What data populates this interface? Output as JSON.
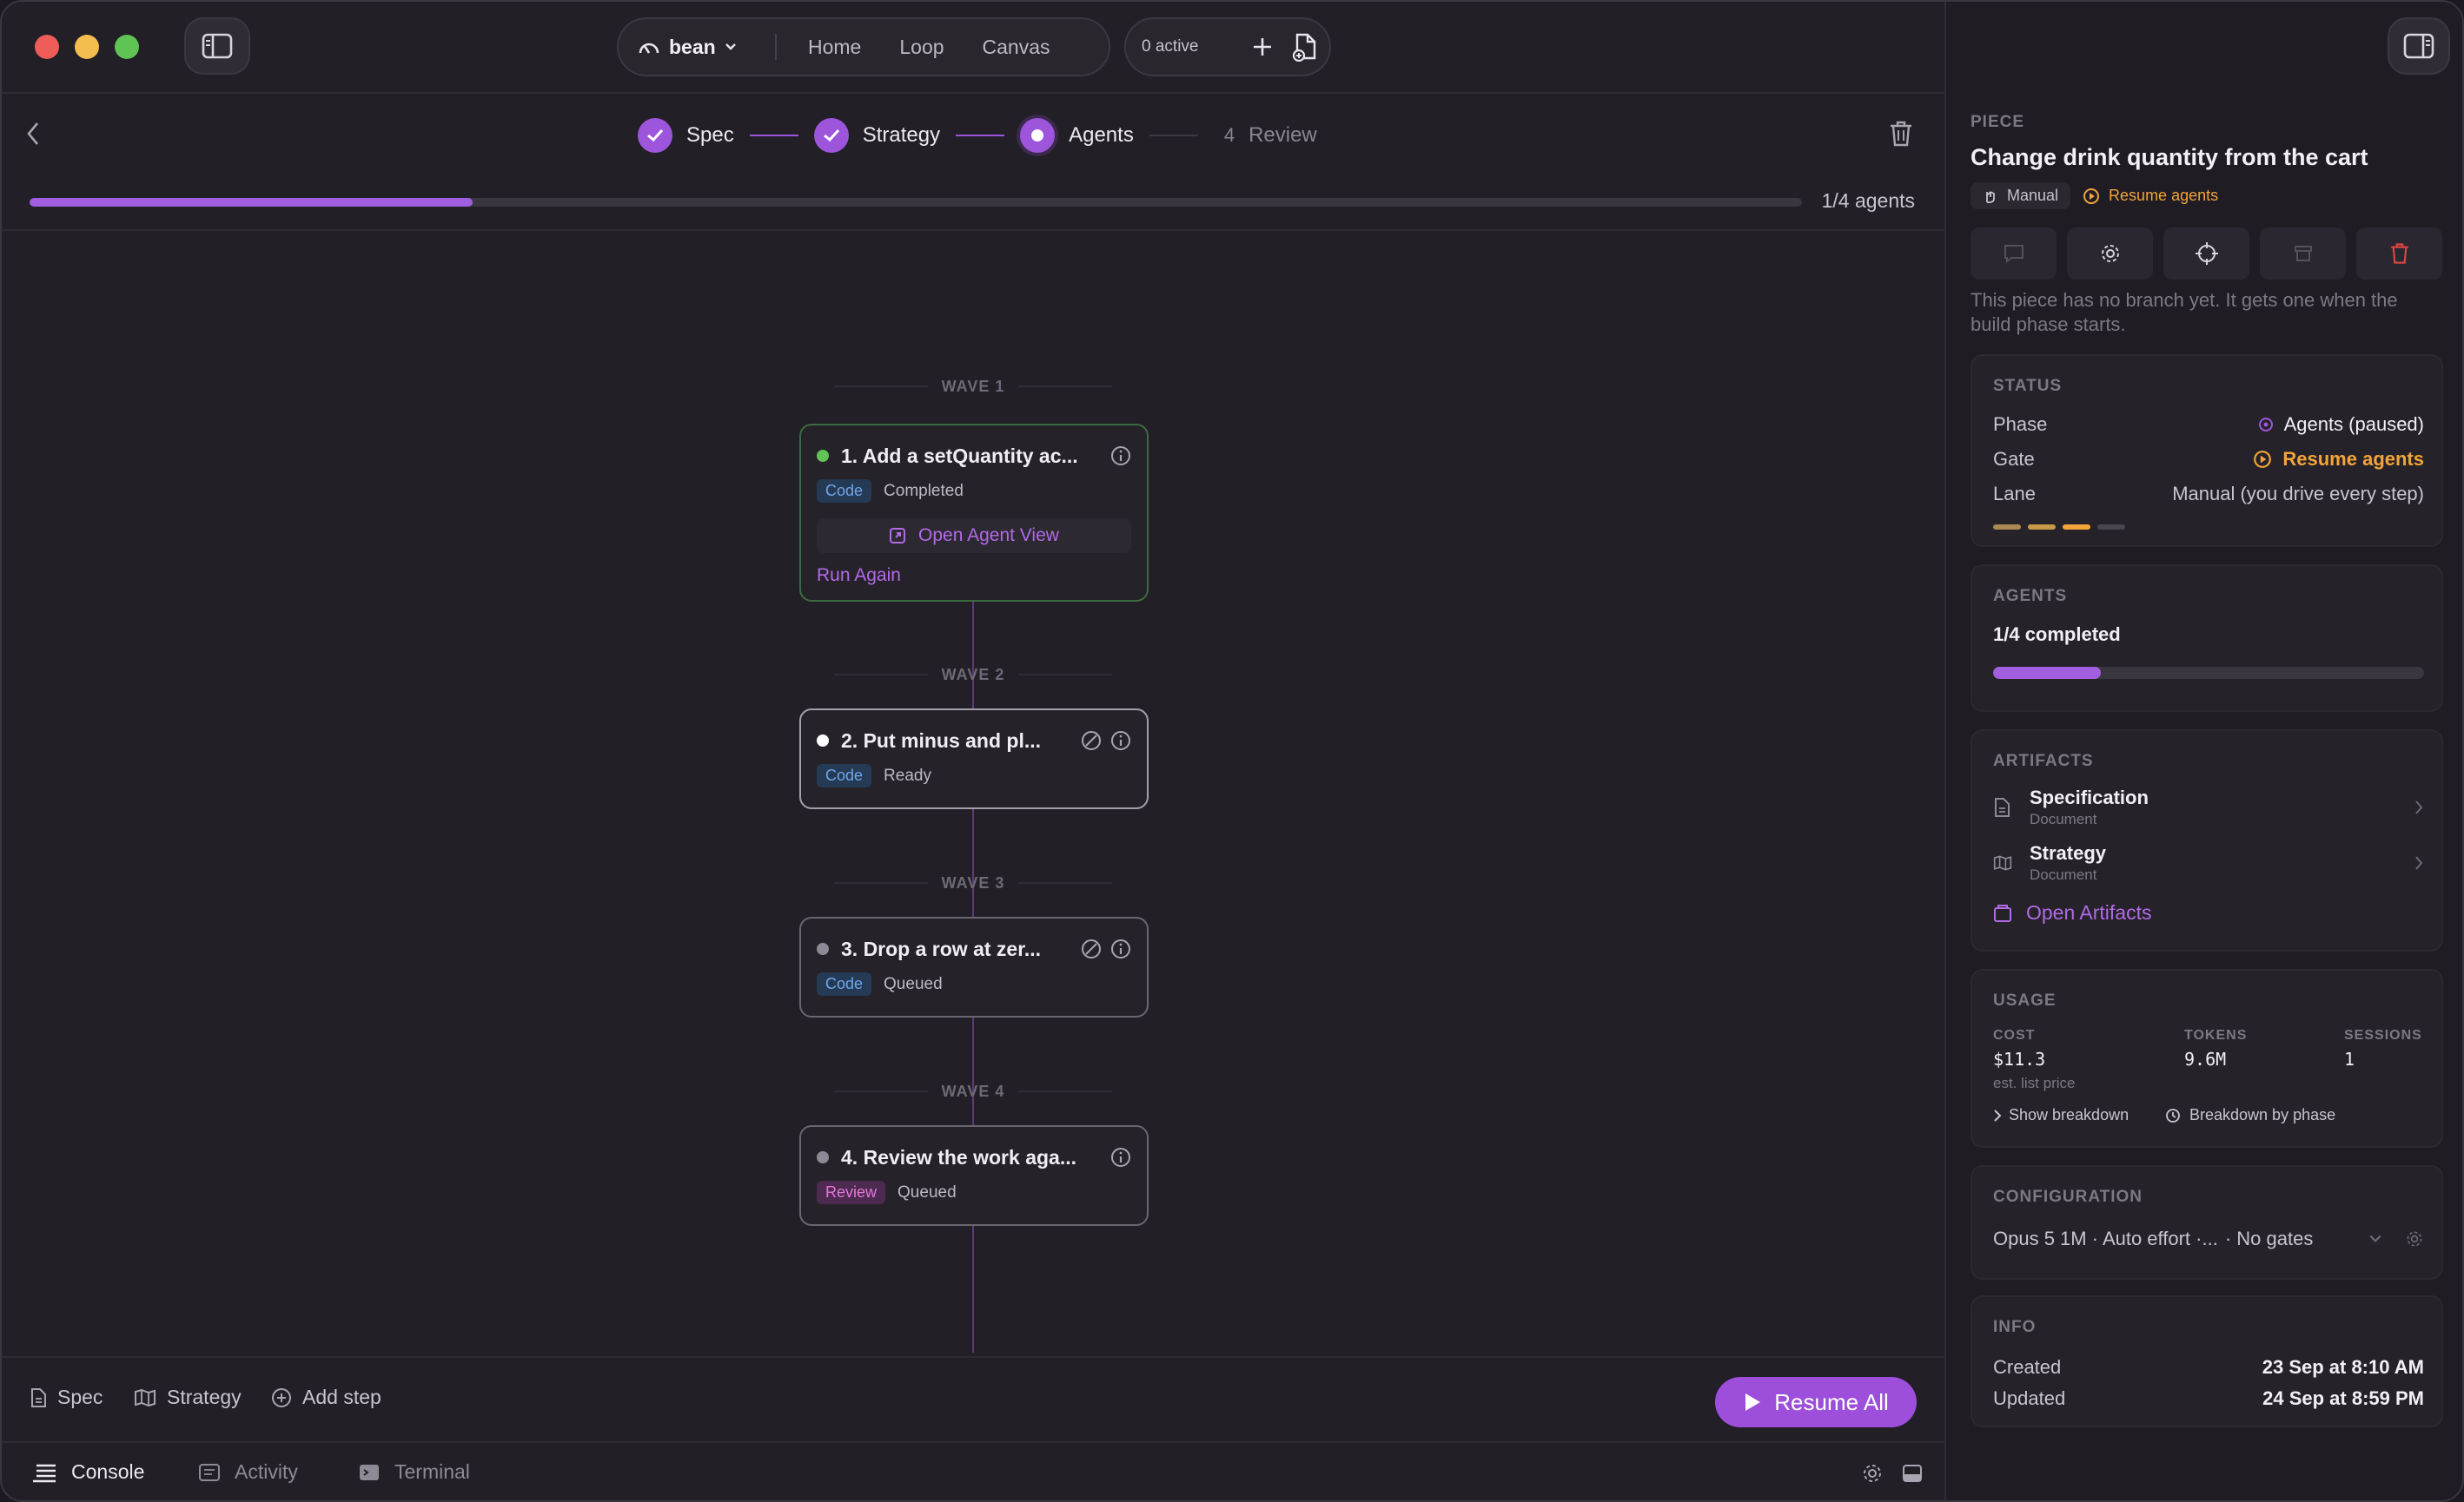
{
  "titlebar": {
    "project": "bean",
    "nav": [
      "Home",
      "Loop",
      "Canvas"
    ],
    "active_count": "0 active"
  },
  "stepper": {
    "steps": [
      {
        "label": "Spec",
        "state": "done"
      },
      {
        "label": "Strategy",
        "state": "done"
      },
      {
        "label": "Agents",
        "state": "current"
      },
      {
        "num": "4",
        "label": "Review",
        "state": "pending"
      }
    ]
  },
  "progress": {
    "label": "1/4 agents",
    "fraction": 0.25
  },
  "waves": [
    "WAVE 1",
    "WAVE 2",
    "WAVE 3",
    "WAVE 4"
  ],
  "cards": [
    {
      "title": "1. Add a setQuantity ac...",
      "tag": "Code",
      "state": "Completed",
      "status_color": "#5fc454",
      "open_label": "Open Agent View",
      "run_again": "Run Again"
    },
    {
      "title": "2. Put minus and pl...",
      "tag": "Code",
      "state": "Ready",
      "status_color": "#ffffff"
    },
    {
      "title": "3. Drop a row at zer...",
      "tag": "Code",
      "state": "Queued",
      "status_color": "#8e8a95"
    },
    {
      "title": "4. Review the work aga...",
      "tag": "Review",
      "state": "Queued",
      "status_color": "#8e8a95"
    }
  ],
  "actionbar": {
    "spec": "Spec",
    "strategy": "Strategy",
    "add_step": "Add step",
    "resume_all": "Resume All"
  },
  "console_tabs": [
    "Console",
    "Activity",
    "Terminal"
  ],
  "panel": {
    "piece_label": "PIECE",
    "title": "Change drink quantity from the cart",
    "chip_manual": "Manual",
    "chip_resume": "Resume agents",
    "note": "This piece has no branch yet. It gets one when the build phase starts.",
    "status": {
      "title": "STATUS",
      "phase_k": "Phase",
      "phase_v": "Agents (paused)",
      "gate_k": "Gate",
      "gate_v": "Resume agents",
      "lane_k": "Lane",
      "lane_v": "Manual (you drive every step)",
      "lane_level": 3,
      "lane_total": 4
    },
    "agents": {
      "title": "AGENTS",
      "summary": "1/4 completed",
      "fraction": 0.25
    },
    "artifacts": {
      "title": "ARTIFACTS",
      "items": [
        {
          "name": "Specification",
          "type": "Document"
        },
        {
          "name": "Strategy",
          "type": "Document"
        }
      ],
      "open_label": "Open Artifacts"
    },
    "usage": {
      "title": "USAGE",
      "cost_h": "COST",
      "cost": "$11.3",
      "cost_note": "est. list price",
      "tokens_h": "TOKENS",
      "tokens": "9.6M",
      "sessions_h": "SESSIONS",
      "sessions": "1",
      "show_breakdown": "Show breakdown",
      "by_phase": "Breakdown by phase"
    },
    "config": {
      "title": "CONFIGURATION",
      "summary": "Opus 5 1M · Auto effort ·...",
      "gates": "· No gates"
    },
    "info": {
      "title": "INFO",
      "created_k": "Created",
      "created_v": "23 Sep at 8:10 AM",
      "updated_k": "Updated",
      "updated_v": "24 Sep at 8:59 PM"
    }
  },
  "colors": {
    "accent": "#9d55db",
    "warn": "#f3a43a",
    "success": "#5fc454"
  }
}
